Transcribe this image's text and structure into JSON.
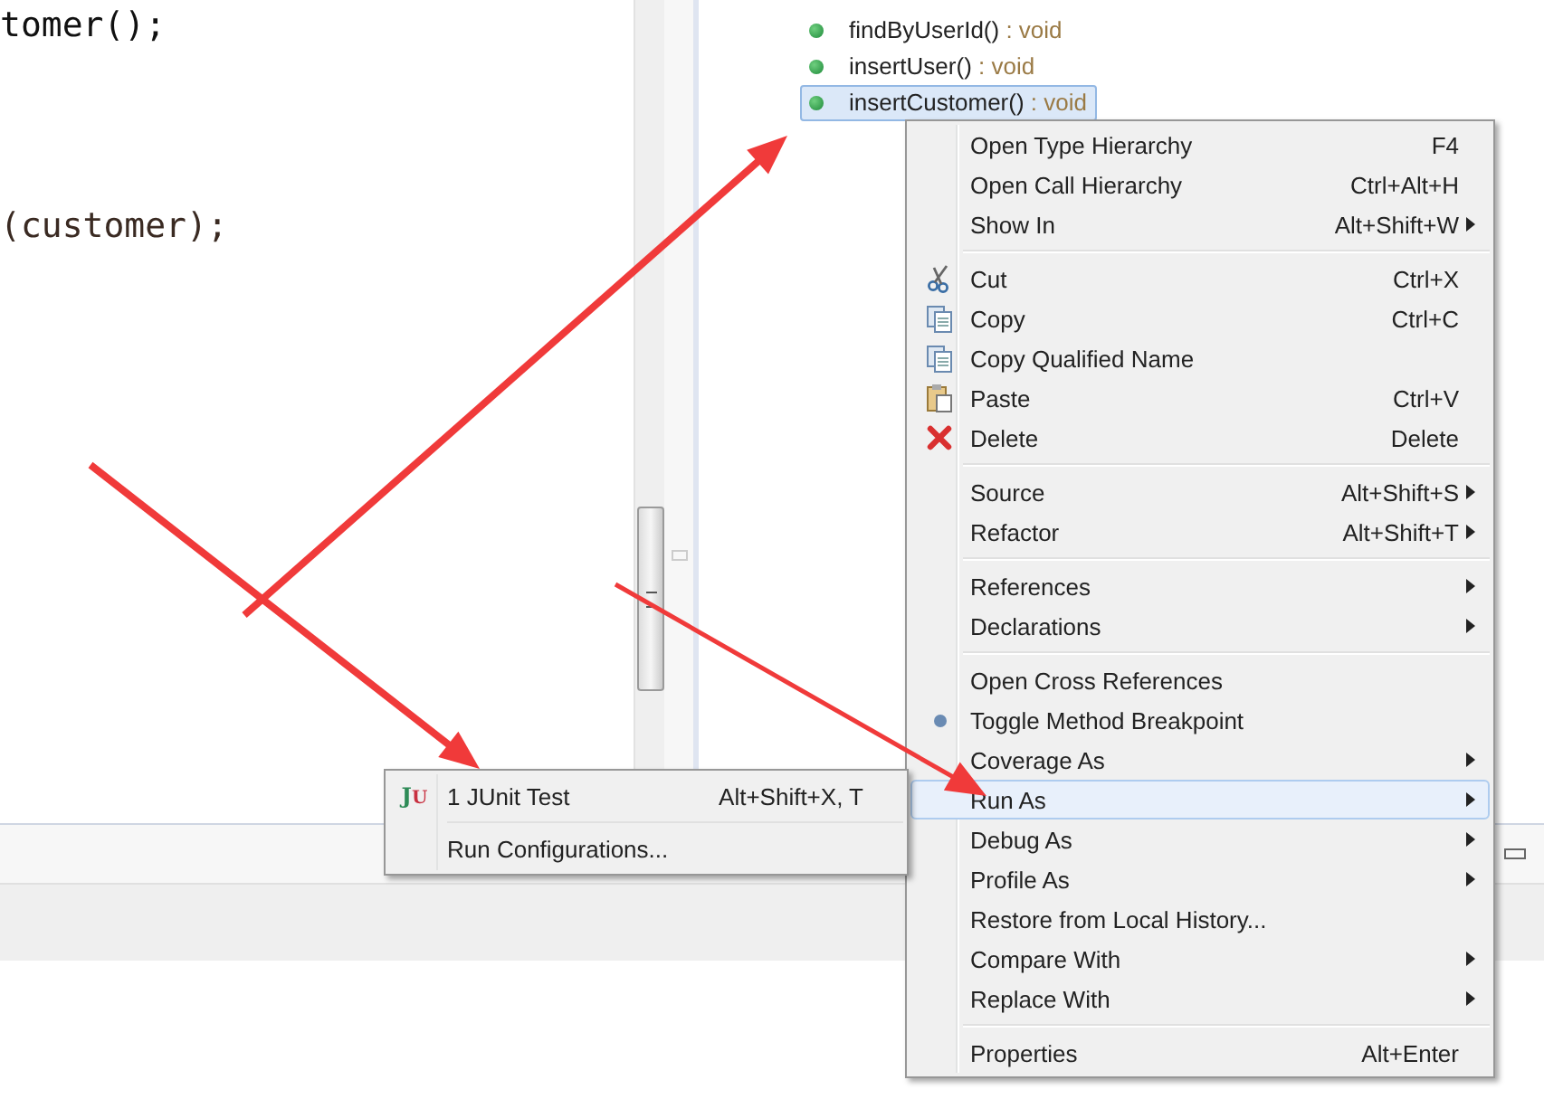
{
  "editor": {
    "code_lines": [
      {
        "text": "tomer();"
      },
      {
        "text": "(customer);"
      }
    ]
  },
  "outline": {
    "items": [
      {
        "name": "findByUserId()",
        "type": ": void",
        "selected": false
      },
      {
        "name": "insertUser()",
        "type": ": void",
        "selected": false
      },
      {
        "name": "insertCustomer()",
        "type": ": void",
        "selected": true
      }
    ]
  },
  "context_menu": {
    "items": [
      {
        "kind": "item",
        "label": "Open Type Hierarchy",
        "shortcut": "F4",
        "submenu": false,
        "selected": false
      },
      {
        "kind": "item",
        "label": "Open Call Hierarchy",
        "shortcut": "Ctrl+Alt+H",
        "submenu": false,
        "selected": false
      },
      {
        "kind": "item",
        "label": "Show In",
        "shortcut": "Alt+Shift+W",
        "submenu": true,
        "selected": false
      },
      {
        "kind": "separator"
      },
      {
        "kind": "item",
        "label": "Cut",
        "shortcut": "Ctrl+X",
        "submenu": false,
        "selected": false
      },
      {
        "kind": "item",
        "label": "Copy",
        "shortcut": "Ctrl+C",
        "submenu": false,
        "selected": false
      },
      {
        "kind": "item",
        "label": "Copy Qualified Name",
        "submenu": false,
        "selected": false
      },
      {
        "kind": "item",
        "label": "Paste",
        "shortcut": "Ctrl+V",
        "submenu": false,
        "selected": false
      },
      {
        "kind": "item",
        "label": "Delete",
        "shortcut": "Delete",
        "submenu": false,
        "selected": false
      },
      {
        "kind": "separator"
      },
      {
        "kind": "item",
        "label": "Source",
        "shortcut": "Alt+Shift+S",
        "submenu": true,
        "selected": false
      },
      {
        "kind": "item",
        "label": "Refactor",
        "shortcut": "Alt+Shift+T",
        "submenu": true,
        "selected": false
      },
      {
        "kind": "separator"
      },
      {
        "kind": "item",
        "label": "References",
        "submenu": true,
        "selected": false
      },
      {
        "kind": "item",
        "label": "Declarations",
        "submenu": true,
        "selected": false
      },
      {
        "kind": "separator"
      },
      {
        "kind": "item",
        "label": "Open Cross References",
        "submenu": false,
        "selected": false
      },
      {
        "kind": "item",
        "label": "Toggle Method Breakpoint",
        "submenu": false,
        "selected": false
      },
      {
        "kind": "item",
        "label": "Coverage As",
        "submenu": true,
        "selected": false
      },
      {
        "kind": "item",
        "label": "Run As",
        "submenu": true,
        "selected": true
      },
      {
        "kind": "item",
        "label": "Debug As",
        "submenu": true,
        "selected": false
      },
      {
        "kind": "item",
        "label": "Profile As",
        "submenu": true,
        "selected": false
      },
      {
        "kind": "item",
        "label": "Restore from Local History...",
        "submenu": false,
        "selected": false
      },
      {
        "kind": "item",
        "label": "Compare With",
        "submenu": true,
        "selected": false
      },
      {
        "kind": "item",
        "label": "Replace With",
        "submenu": true,
        "selected": false
      },
      {
        "kind": "separator"
      },
      {
        "kind": "item",
        "label": "Properties",
        "shortcut": "Alt+Enter",
        "submenu": false,
        "selected": false
      }
    ]
  },
  "run_as_submenu": {
    "items": [
      {
        "kind": "item",
        "label": "1 JUnit Test",
        "shortcut": "Alt+Shift+X, T",
        "icon_letters": [
          "J",
          "U"
        ]
      },
      {
        "kind": "separator"
      },
      {
        "kind": "item",
        "label": "Run Configurations..."
      }
    ]
  }
}
